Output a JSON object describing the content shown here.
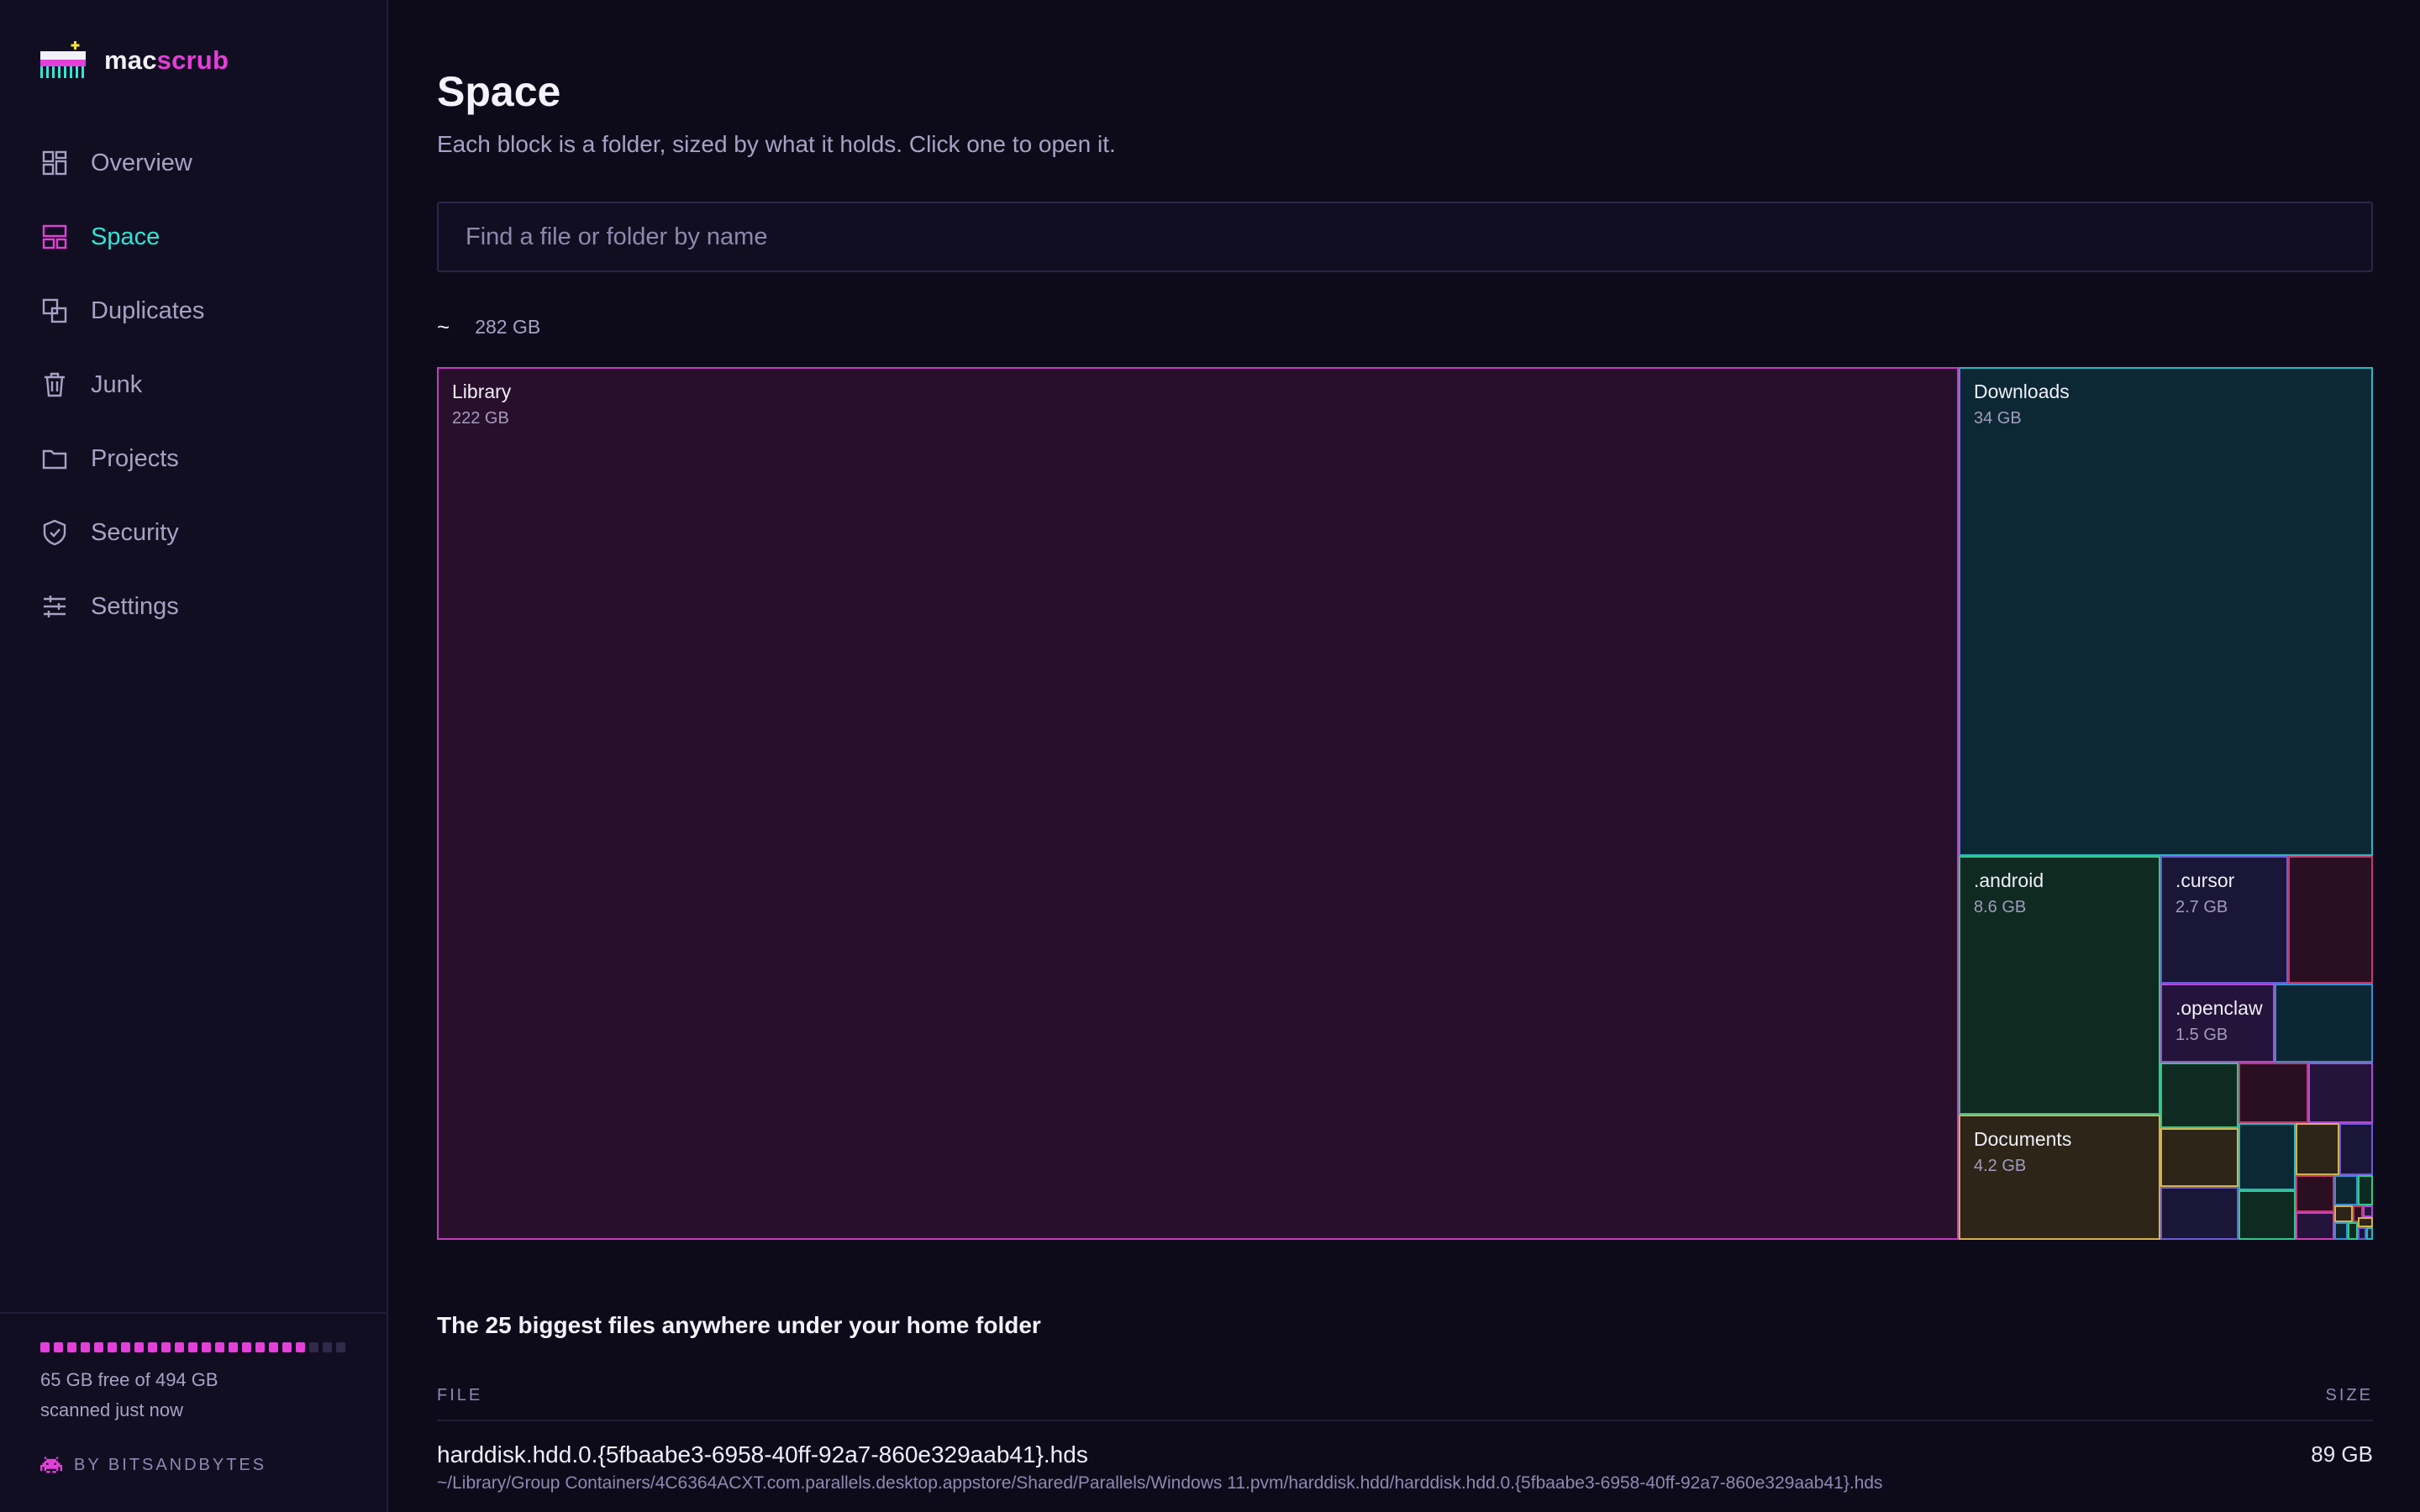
{
  "app": {
    "name_part1": "mac",
    "name_part2": "scrub"
  },
  "nav": [
    {
      "label": "Overview",
      "icon": "overview-icon",
      "active": false
    },
    {
      "label": "Space",
      "icon": "space-icon",
      "active": true
    },
    {
      "label": "Duplicates",
      "icon": "duplicates-icon",
      "active": false
    },
    {
      "label": "Junk",
      "icon": "trash-icon",
      "active": false
    },
    {
      "label": "Projects",
      "icon": "folder-icon",
      "active": false
    },
    {
      "label": "Security",
      "icon": "shield-icon",
      "active": false
    },
    {
      "label": "Settings",
      "icon": "sliders-icon",
      "active": false
    }
  ],
  "storage": {
    "free_text": "65 GB free of 494 GB",
    "scan_status": "scanned just now",
    "used_fraction": 0.868
  },
  "credit": "BY BITSANDBYTES",
  "page": {
    "title": "Space",
    "subtitle": "Each block is a folder, sized by what it holds. Click one to open it."
  },
  "search": {
    "placeholder": "Find a file or folder by name",
    "value": ""
  },
  "breadcrumb": {
    "path": "~",
    "total": "282 GB"
  },
  "treemap": {
    "folders": [
      {
        "name": "Library",
        "size": "222 GB"
      },
      {
        "name": "Downloads",
        "size": "34 GB"
      },
      {
        "name": ".android",
        "size": "8.6 GB"
      },
      {
        "name": ".cursor",
        "size": "2.7 GB"
      },
      {
        "name": ".openclaw",
        "size": "1.5 GB"
      },
      {
        "name": "Documents",
        "size": "4.2 GB"
      }
    ]
  },
  "colors": {
    "accent_magenta": "#e53fd9",
    "accent_cyan": "#2fe6d5",
    "background": "#0d0b1a",
    "sidebar": "#110e22"
  },
  "files": {
    "heading": "The 25 biggest files anywhere under your home folder",
    "col_file": "FILE",
    "col_size": "SIZE",
    "rows": [
      {
        "name": "harddisk.hdd.0.{5fbaabe3-6958-40ff-92a7-860e329aab41}.hds",
        "path": "~/Library/Group Containers/4C6364ACXT.com.parallels.desktop.appstore/Shared/Parallels/Windows 11.pvm/harddisk.hdd/harddisk.hdd.0.{5fbaabe3-6958-40ff-92a7-860e329aab41}.hds",
        "size": "89 GB"
      }
    ]
  }
}
